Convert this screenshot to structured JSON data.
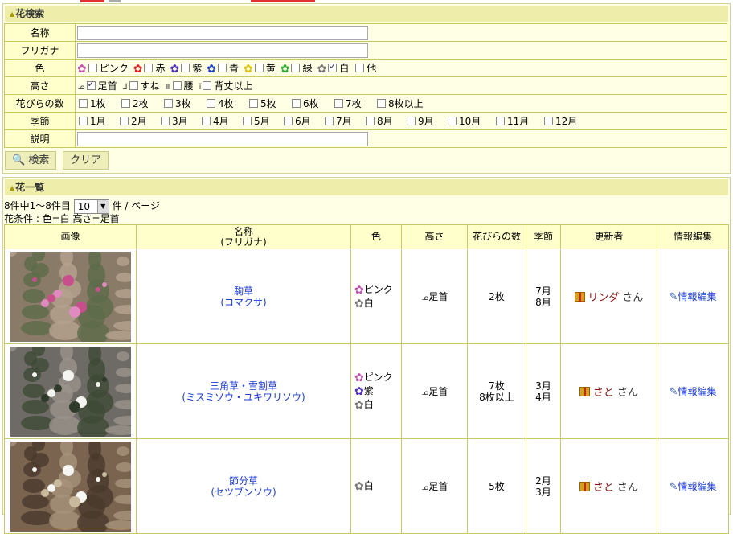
{
  "search": {
    "title": "花検索",
    "labels": {
      "name": "名称",
      "furigana": "フリガナ",
      "color": "色",
      "height": "高さ",
      "petals": "花びらの数",
      "season": "季節",
      "desc": "説明"
    },
    "colors": [
      {
        "label": "ピンク",
        "checked": false,
        "glyph": "✿",
        "hex": "#c050b0"
      },
      {
        "label": "赤",
        "checked": false,
        "glyph": "✿",
        "hex": "#e02020"
      },
      {
        "label": "紫",
        "checked": false,
        "glyph": "✿",
        "hex": "#5030c0"
      },
      {
        "label": "青",
        "checked": false,
        "glyph": "✿",
        "hex": "#2040d0"
      },
      {
        "label": "黄",
        "checked": false,
        "glyph": "✿",
        "hex": "#e0c000"
      },
      {
        "label": "緑",
        "checked": false,
        "glyph": "✿",
        "hex": "#30b030"
      },
      {
        "label": "白",
        "checked": true,
        "glyph": "✿",
        "hex": "#777777"
      },
      {
        "label": "他",
        "checked": false,
        "glyph": "",
        "hex": ""
      }
    ],
    "heights": [
      {
        "label": "足首",
        "checked": true
      },
      {
        "label": "すね",
        "checked": false
      },
      {
        "label": "腰",
        "checked": false
      },
      {
        "label": "背丈以上",
        "checked": false
      }
    ],
    "petals": [
      "1枚",
      "2枚",
      "3枚",
      "4枚",
      "5枚",
      "6枚",
      "7枚",
      "8枚以上"
    ],
    "months": [
      "1月",
      "2月",
      "3月",
      "4月",
      "5月",
      "6月",
      "7月",
      "8月",
      "9月",
      "10月",
      "11月",
      "12月"
    ],
    "search_button": "検索",
    "clear_button": "クリア"
  },
  "list": {
    "title": "花一覧",
    "count_text": "8件中1～8件目",
    "per_page_value": "10",
    "per_page_suffix": "件 / ページ",
    "condition": "花条件 : 色=白 高さ=足首",
    "headers": {
      "image": "画像",
      "name": "名称",
      "name_sub": "(フリガナ)",
      "color": "色",
      "height": "高さ",
      "petals": "花びらの数",
      "season": "季節",
      "updater": "更新者",
      "edit": "情報編集"
    },
    "rows": [
      {
        "name": "駒草",
        "furigana": "(コマクサ)",
        "colors": [
          {
            "label": "ピンク",
            "hex": "#c050b0"
          },
          {
            "label": "白",
            "hex": "#777777"
          }
        ],
        "height": "足首",
        "petals": [
          "2枚"
        ],
        "season": [
          "7月",
          "8月"
        ],
        "updater": "リンダ",
        "san": "さん",
        "edit": "情報編集"
      },
      {
        "name": "三角草・雪割草",
        "furigana": "(ミスミソウ・ユキワリソウ)",
        "colors": [
          {
            "label": "ピンク",
            "hex": "#c050b0"
          },
          {
            "label": "紫",
            "hex": "#5030c0"
          },
          {
            "label": "白",
            "hex": "#777777"
          }
        ],
        "height": "足首",
        "petals": [
          "7枚",
          "8枚以上"
        ],
        "season": [
          "3月",
          "4月"
        ],
        "updater": "さと",
        "san": "さん",
        "edit": "情報編集"
      },
      {
        "name": "節分草",
        "furigana": "(セツブンソウ)",
        "colors": [
          {
            "label": "白",
            "hex": "#777777"
          }
        ],
        "height": "足首",
        "petals": [
          "5枚"
        ],
        "season": [
          "2月",
          "3月"
        ],
        "updater": "さと",
        "san": "さん",
        "edit": "情報編集"
      }
    ]
  }
}
